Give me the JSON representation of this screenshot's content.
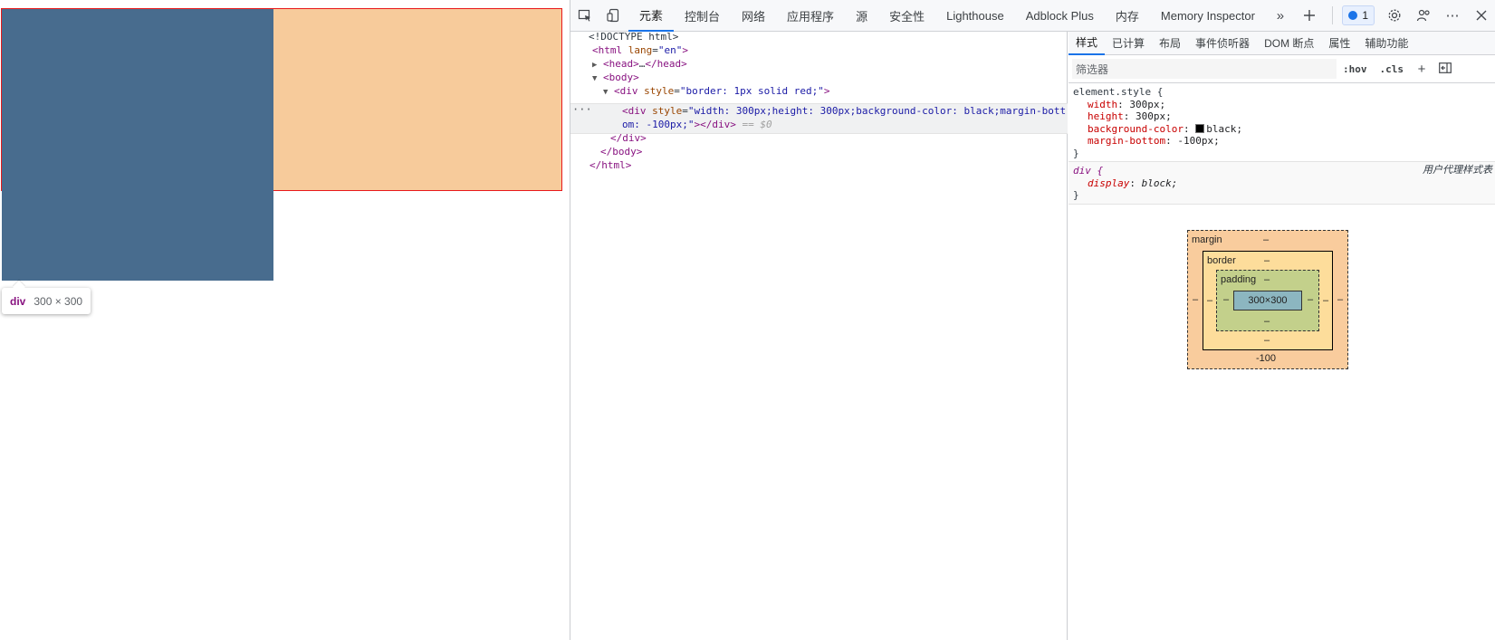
{
  "viewport": {
    "tooltip": {
      "tag": "div",
      "size": "300 × 300"
    }
  },
  "toolbar": {
    "tabs": [
      "元素",
      "控制台",
      "网络",
      "应用程序",
      "源",
      "安全性",
      "Lighthouse",
      "Adblock Plus",
      "内存",
      "Memory Inspector"
    ],
    "active_tab": "元素",
    "issues_count": "1"
  },
  "dom": {
    "line1": "<!DOCTYPE html>",
    "html_open": "<html",
    "html_attr": "lang",
    "html_val": "\"en\"",
    "html_close": ">",
    "head": "<head>",
    "head_ellipsis": "…",
    "head_end": "</head>",
    "body_open": "<body>",
    "div_open": "<div",
    "div_attr": "style",
    "div_val": "\"border: 1px solid red;\"",
    "div_close": ">",
    "inner_open": "<div",
    "inner_attr": "style",
    "inner_val_1": "\"width: 300px;height: 300px;background-color: black;margin-bott",
    "inner_val_2": "om: -100px;\"",
    "inner_close": "></div>",
    "inner_ref": "== $0",
    "div_end": "</div>",
    "body_end": "</body>",
    "html_end": "</html>",
    "dots": "···"
  },
  "styles": {
    "sub_tabs": [
      "样式",
      "已计算",
      "布局",
      "事件侦听器",
      "DOM 断点",
      "属性",
      "辅助功能"
    ],
    "active_sub_tab": "样式",
    "filter_placeholder": "筛选器",
    "hov": ":hov",
    "cls": ".cls",
    "element_style_selector": "element.style {",
    "props": [
      {
        "name": "width",
        "value": "300px;"
      },
      {
        "name": "height",
        "value": "300px;"
      },
      {
        "name": "background-color",
        "value": "black;"
      },
      {
        "name": "margin-bottom",
        "value": "-100px;"
      }
    ],
    "close_brace": "}",
    "ua_selector": "div {",
    "ua_source": "用户代理样式表",
    "ua_prop_name": "display",
    "ua_prop_value": "block;"
  },
  "box_model": {
    "margin_label": "margin",
    "border_label": "border",
    "padding_label": "padding",
    "content": "300×300",
    "dash": "–",
    "margin_bottom": "-100"
  },
  "colors": {
    "outer_bg": "#f7cb9b",
    "inner_bg": "#486c8e",
    "outer_border": "#e8191b",
    "accent": "#1a73e8"
  }
}
